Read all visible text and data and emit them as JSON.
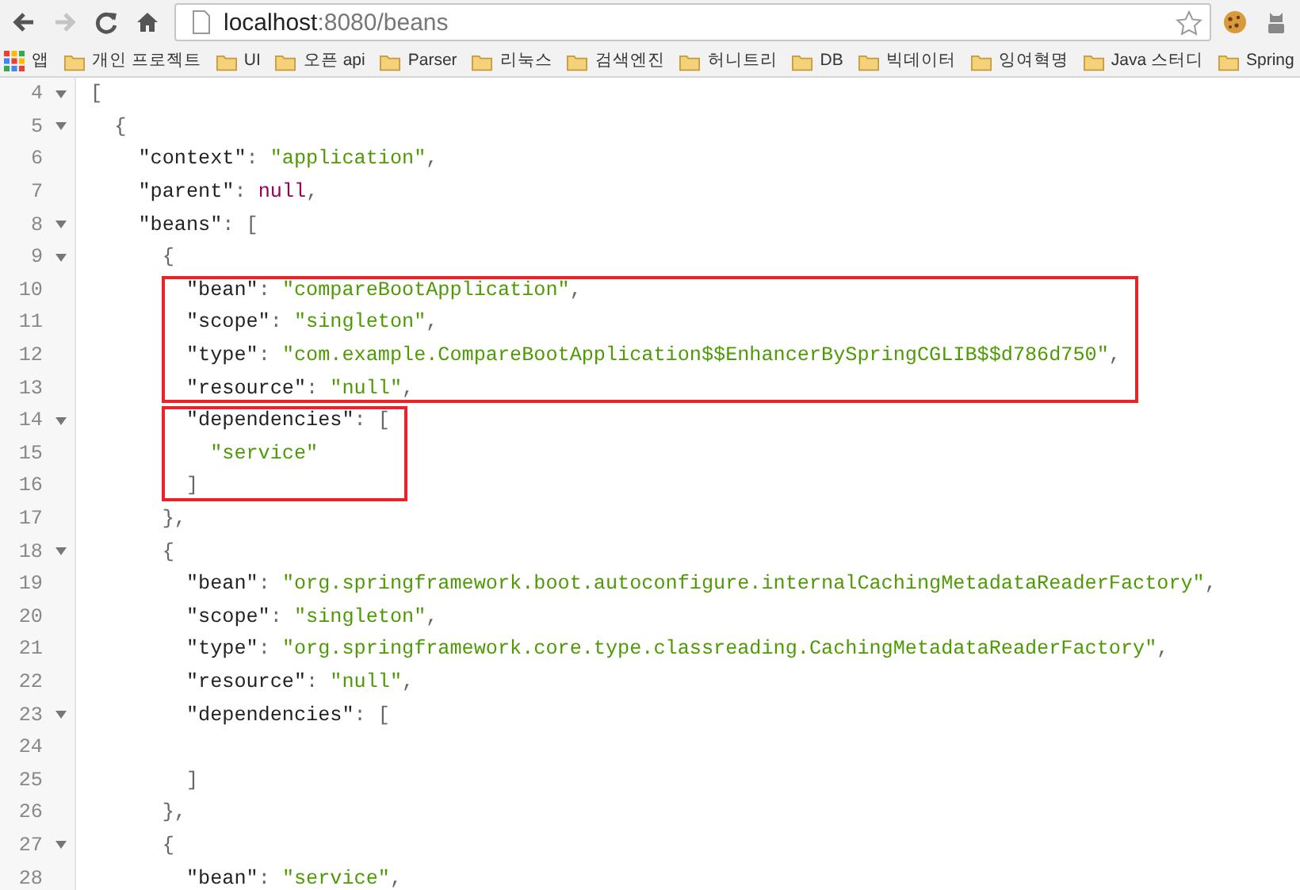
{
  "toolbar": {
    "back_disabled": false,
    "forward_disabled": true,
    "address": {
      "host": "localhost",
      "path": ":8080/beans"
    }
  },
  "bookmarks": {
    "apps_label": "앱",
    "folders": [
      "개인 프로젝트",
      "UI",
      "오픈 api",
      "Parser",
      "리눅스",
      "검색엔진",
      "허니트리",
      "DB",
      "빅데이터",
      "잉여혁명",
      "Java 스터디",
      "Spring"
    ]
  },
  "code": {
    "blocks": [
      {
        "boxed": false,
        "lines": [
          {
            "number": "4",
            "foldable": true,
            "tokens": [
              {
                "kind": "punct",
                "text": "["
              }
            ]
          },
          {
            "number": "5",
            "foldable": true,
            "tokens": [
              {
                "kind": "punct",
                "text": "  {"
              }
            ]
          },
          {
            "number": "6",
            "foldable": false,
            "tokens": [
              {
                "kind": "key",
                "text": "    \"context\""
              },
              {
                "kind": "punct",
                "text": ": "
              },
              {
                "kind": "string",
                "text": "\"application\""
              },
              {
                "kind": "punct",
                "text": ","
              }
            ]
          },
          {
            "number": "7",
            "foldable": false,
            "tokens": [
              {
                "kind": "key",
                "text": "    \"parent\""
              },
              {
                "kind": "punct",
                "text": ": "
              },
              {
                "kind": "null",
                "text": "null"
              },
              {
                "kind": "punct",
                "text": ","
              }
            ]
          },
          {
            "number": "8",
            "foldable": true,
            "tokens": [
              {
                "kind": "key",
                "text": "    \"beans\""
              },
              {
                "kind": "punct",
                "text": ": ["
              }
            ]
          },
          {
            "number": "9",
            "foldable": true,
            "tokens": [
              {
                "kind": "punct",
                "text": "      {"
              }
            ]
          }
        ]
      },
      {
        "boxed": true,
        "lines": [
          {
            "number": "10",
            "foldable": false,
            "tokens": [
              {
                "kind": "key",
                "text": "        \"bean\""
              },
              {
                "kind": "punct",
                "text": ": "
              },
              {
                "kind": "string",
                "text": "\"compareBootApplication\""
              },
              {
                "kind": "punct",
                "text": ","
              }
            ]
          },
          {
            "number": "11",
            "foldable": false,
            "tokens": [
              {
                "kind": "key",
                "text": "        \"scope\""
              },
              {
                "kind": "punct",
                "text": ": "
              },
              {
                "kind": "string",
                "text": "\"singleton\""
              },
              {
                "kind": "punct",
                "text": ","
              }
            ]
          },
          {
            "number": "12",
            "foldable": false,
            "tokens": [
              {
                "kind": "key",
                "text": "        \"type\""
              },
              {
                "kind": "punct",
                "text": ": "
              },
              {
                "kind": "string",
                "text": "\"com.example.CompareBootApplication$$EnhancerBySpringCGLIB$$d786d750\""
              },
              {
                "kind": "punct",
                "text": ","
              }
            ]
          },
          {
            "number": "13",
            "foldable": false,
            "tokens": [
              {
                "kind": "key",
                "text": "        \"resource\""
              },
              {
                "kind": "punct",
                "text": ": "
              },
              {
                "kind": "string",
                "text": "\"null\""
              },
              {
                "kind": "punct",
                "text": ","
              }
            ]
          }
        ]
      },
      {
        "boxed": true,
        "lines": [
          {
            "number": "14",
            "foldable": true,
            "tokens": [
              {
                "kind": "key",
                "text": "        \"dependencies\""
              },
              {
                "kind": "punct",
                "text": ": ["
              }
            ]
          },
          {
            "number": "15",
            "foldable": false,
            "tokens": [
              {
                "kind": "string",
                "text": "          \"service\""
              }
            ]
          },
          {
            "number": "16",
            "foldable": false,
            "tokens": [
              {
                "kind": "punct",
                "text": "        ]"
              }
            ]
          }
        ]
      },
      {
        "boxed": false,
        "lines": [
          {
            "number": "17",
            "foldable": false,
            "tokens": [
              {
                "kind": "punct",
                "text": "      },"
              }
            ]
          },
          {
            "number": "18",
            "foldable": true,
            "tokens": [
              {
                "kind": "punct",
                "text": "      {"
              }
            ]
          },
          {
            "number": "19",
            "foldable": false,
            "tokens": [
              {
                "kind": "key",
                "text": "        \"bean\""
              },
              {
                "kind": "punct",
                "text": ": "
              },
              {
                "kind": "string",
                "text": "\"org.springframework.boot.autoconfigure.internalCachingMetadataReaderFactory\""
              },
              {
                "kind": "punct",
                "text": ","
              }
            ]
          },
          {
            "number": "20",
            "foldable": false,
            "tokens": [
              {
                "kind": "key",
                "text": "        \"scope\""
              },
              {
                "kind": "punct",
                "text": ": "
              },
              {
                "kind": "string",
                "text": "\"singleton\""
              },
              {
                "kind": "punct",
                "text": ","
              }
            ]
          },
          {
            "number": "21",
            "foldable": false,
            "tokens": [
              {
                "kind": "key",
                "text": "        \"type\""
              },
              {
                "kind": "punct",
                "text": ": "
              },
              {
                "kind": "string",
                "text": "\"org.springframework.core.type.classreading.CachingMetadataReaderFactory\""
              },
              {
                "kind": "punct",
                "text": ","
              }
            ]
          },
          {
            "number": "22",
            "foldable": false,
            "tokens": [
              {
                "kind": "key",
                "text": "        \"resource\""
              },
              {
                "kind": "punct",
                "text": ": "
              },
              {
                "kind": "string",
                "text": "\"null\""
              },
              {
                "kind": "punct",
                "text": ","
              }
            ]
          },
          {
            "number": "23",
            "foldable": true,
            "tokens": [
              {
                "kind": "key",
                "text": "        \"dependencies\""
              },
              {
                "kind": "punct",
                "text": ": ["
              }
            ]
          },
          {
            "number": "24",
            "foldable": false
          },
          {
            "number": "25",
            "foldable": false,
            "tokens": [
              {
                "kind": "punct",
                "text": "        ]"
              }
            ]
          },
          {
            "number": "26",
            "foldable": false,
            "tokens": [
              {
                "kind": "punct",
                "text": "      },"
              }
            ]
          },
          {
            "number": "27",
            "foldable": true,
            "tokens": [
              {
                "kind": "punct",
                "text": "      {"
              }
            ]
          },
          {
            "number": "28",
            "foldable": false,
            "tokens": [
              {
                "kind": "key",
                "text": "        \"bean\""
              },
              {
                "kind": "punct",
                "text": ": "
              },
              {
                "kind": "string",
                "text": "\"service\""
              },
              {
                "kind": "punct",
                "text": ","
              }
            ]
          }
        ]
      }
    ]
  }
}
